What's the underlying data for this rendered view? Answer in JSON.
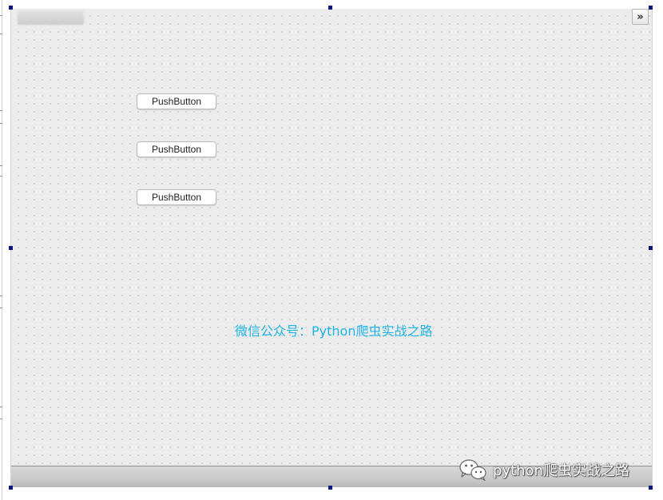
{
  "form": {
    "title_placeholder": "",
    "expand_icon": "double-chevron-right-icon",
    "expand_glyph": "»",
    "grid": true
  },
  "buttons": [
    {
      "label": "PushButton"
    },
    {
      "label": "PushButton"
    },
    {
      "label": "PushButton"
    }
  ],
  "label": {
    "text": "微信公众号：Python爬虫实战之路",
    "color": "#1fb4e6"
  },
  "watermark": {
    "text": "python爬虫实战之路",
    "icon": "wechat-icon"
  },
  "colors": {
    "selection_handle": "#0a1a7a",
    "form_background": "#ececec"
  }
}
